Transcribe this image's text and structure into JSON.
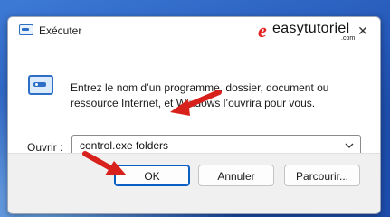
{
  "window": {
    "title": "Exécuter",
    "close_glyph": "✕"
  },
  "watermark": {
    "brand_e": "e",
    "brand_name": "easytutoriel",
    "brand_tld": ".com"
  },
  "dialog": {
    "description": "Entrez le nom d’un programme, dossier, document ou ressource Internet, et Windows l’ouvrira pour vous.",
    "open_label": "Ouvrir :",
    "open_value": "control.exe folders"
  },
  "buttons": {
    "ok": "OK",
    "cancel": "Annuler",
    "browse": "Parcourir..."
  },
  "colors": {
    "accent": "#0a5fc4",
    "arrow_red": "#d8201c",
    "brand_red": "#e32222"
  },
  "icons": {
    "title": "run-icon",
    "dialog": "run-icon",
    "close": "close-icon",
    "dropdown": "chevron-down-icon"
  }
}
